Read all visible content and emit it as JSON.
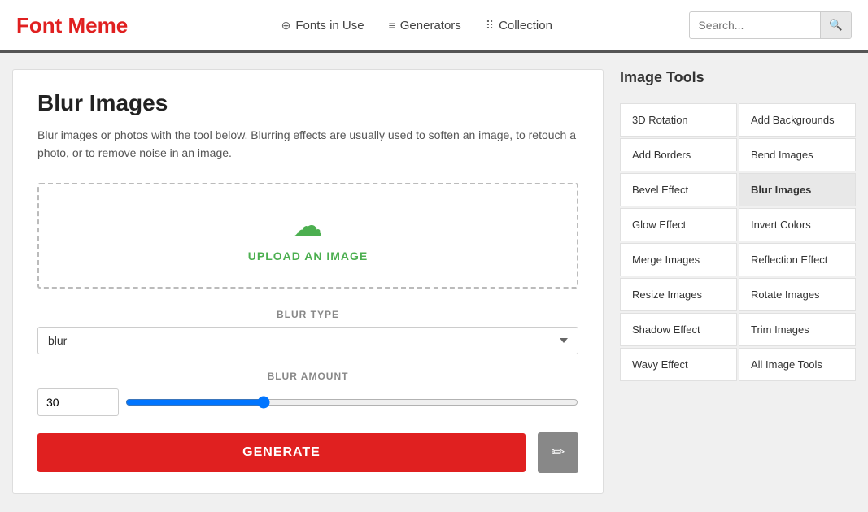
{
  "header": {
    "logo": "Font Meme",
    "nav": [
      {
        "label": "Fonts in Use",
        "icon": "⊕"
      },
      {
        "label": "Generators",
        "icon": "≡"
      },
      {
        "label": "Collection",
        "icon": "⠿"
      }
    ],
    "search_placeholder": "Search..."
  },
  "main": {
    "title": "Blur Images",
    "description": "Blur images or photos with the tool below. Blurring effects are usually used to soften an image, to retouch a photo, or to remove noise in an image.",
    "upload_label": "UPLOAD AN IMAGE",
    "blur_type_label": "BLUR TYPE",
    "blur_type_value": "blur",
    "blur_amount_label": "BLUR AMOUNT",
    "blur_amount_value": "30",
    "generate_label": "GENERATE"
  },
  "sidebar": {
    "title": "Image Tools",
    "tools": [
      {
        "label": "3D Rotation",
        "col": 0
      },
      {
        "label": "Add Backgrounds",
        "col": 1
      },
      {
        "label": "Add Borders",
        "col": 0
      },
      {
        "label": "Bend Images",
        "col": 1
      },
      {
        "label": "Bevel Effect",
        "col": 0
      },
      {
        "label": "Blur Images",
        "col": 1,
        "active": true
      },
      {
        "label": "Glow Effect",
        "col": 0
      },
      {
        "label": "Invert Colors",
        "col": 1
      },
      {
        "label": "Merge Images",
        "col": 0
      },
      {
        "label": "Reflection Effect",
        "col": 1
      },
      {
        "label": "Resize Images",
        "col": 0
      },
      {
        "label": "Rotate Images",
        "col": 1
      },
      {
        "label": "Shadow Effect",
        "col": 0
      },
      {
        "label": "Trim Images",
        "col": 1
      },
      {
        "label": "Wavy Effect",
        "col": 0
      },
      {
        "label": "All Image Tools",
        "col": 1
      }
    ]
  }
}
